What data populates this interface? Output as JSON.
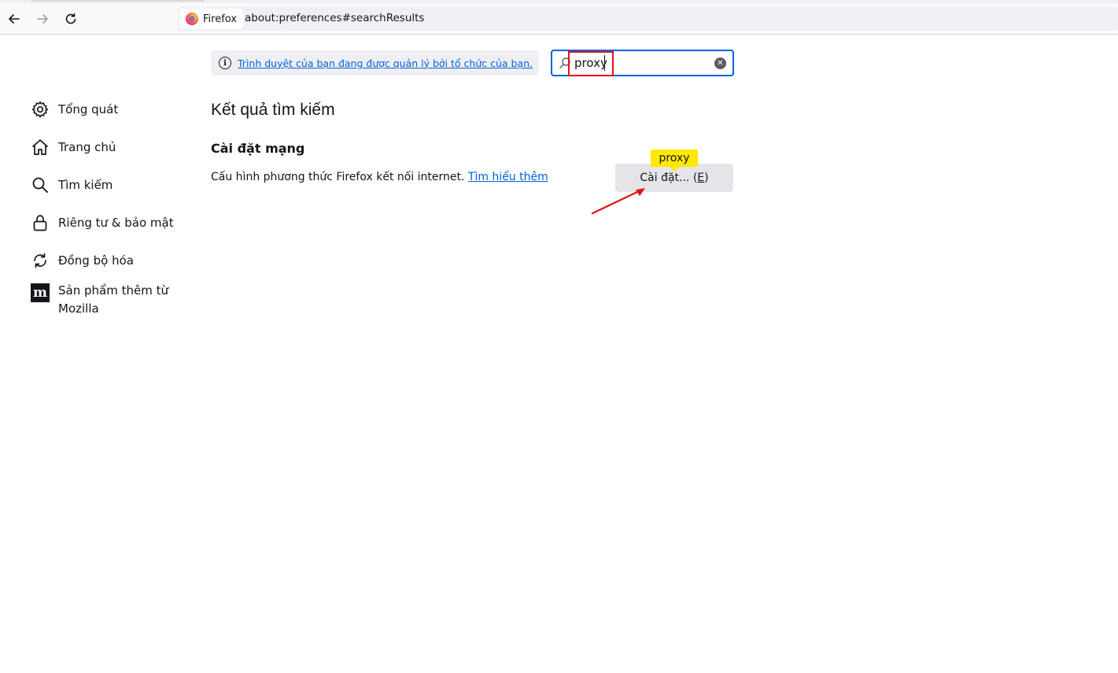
{
  "browser": {
    "identity_label": "Firefox",
    "url": "about:preferences#searchResults"
  },
  "sidebar": {
    "items": [
      {
        "label": "Tổng quát",
        "icon": "gear-icon"
      },
      {
        "label": "Trang chủ",
        "icon": "home-icon"
      },
      {
        "label": "Tìm kiếm",
        "icon": "search-icon"
      },
      {
        "label": "Riêng tư & bảo mật",
        "icon": "lock-icon"
      },
      {
        "label": "Đồng bộ hóa",
        "icon": "sync-icon"
      },
      {
        "label": "Sản phẩm thêm từ Mozilla",
        "icon": "mozilla-icon"
      }
    ]
  },
  "policy": {
    "text": "Trình duyệt của bạn đang được quản lý bởi tổ chức của bạn."
  },
  "search": {
    "value": "proxy"
  },
  "main": {
    "heading": "Kết quả tìm kiếm",
    "group_title": "Cài đặt mạng",
    "description": "Cấu hình phương thức Firefox kết nối internet.",
    "learn_more": "Tìm hiểu thêm",
    "settings_button_prefix": "Cài đặt... (",
    "settings_button_accesskey": "E",
    "settings_button_suffix": ")",
    "tooltip": "proxy"
  },
  "colors": {
    "accent": "#0061e0",
    "highlight_tooltip": "#ffe900",
    "annotation_red": "#e0121b"
  }
}
